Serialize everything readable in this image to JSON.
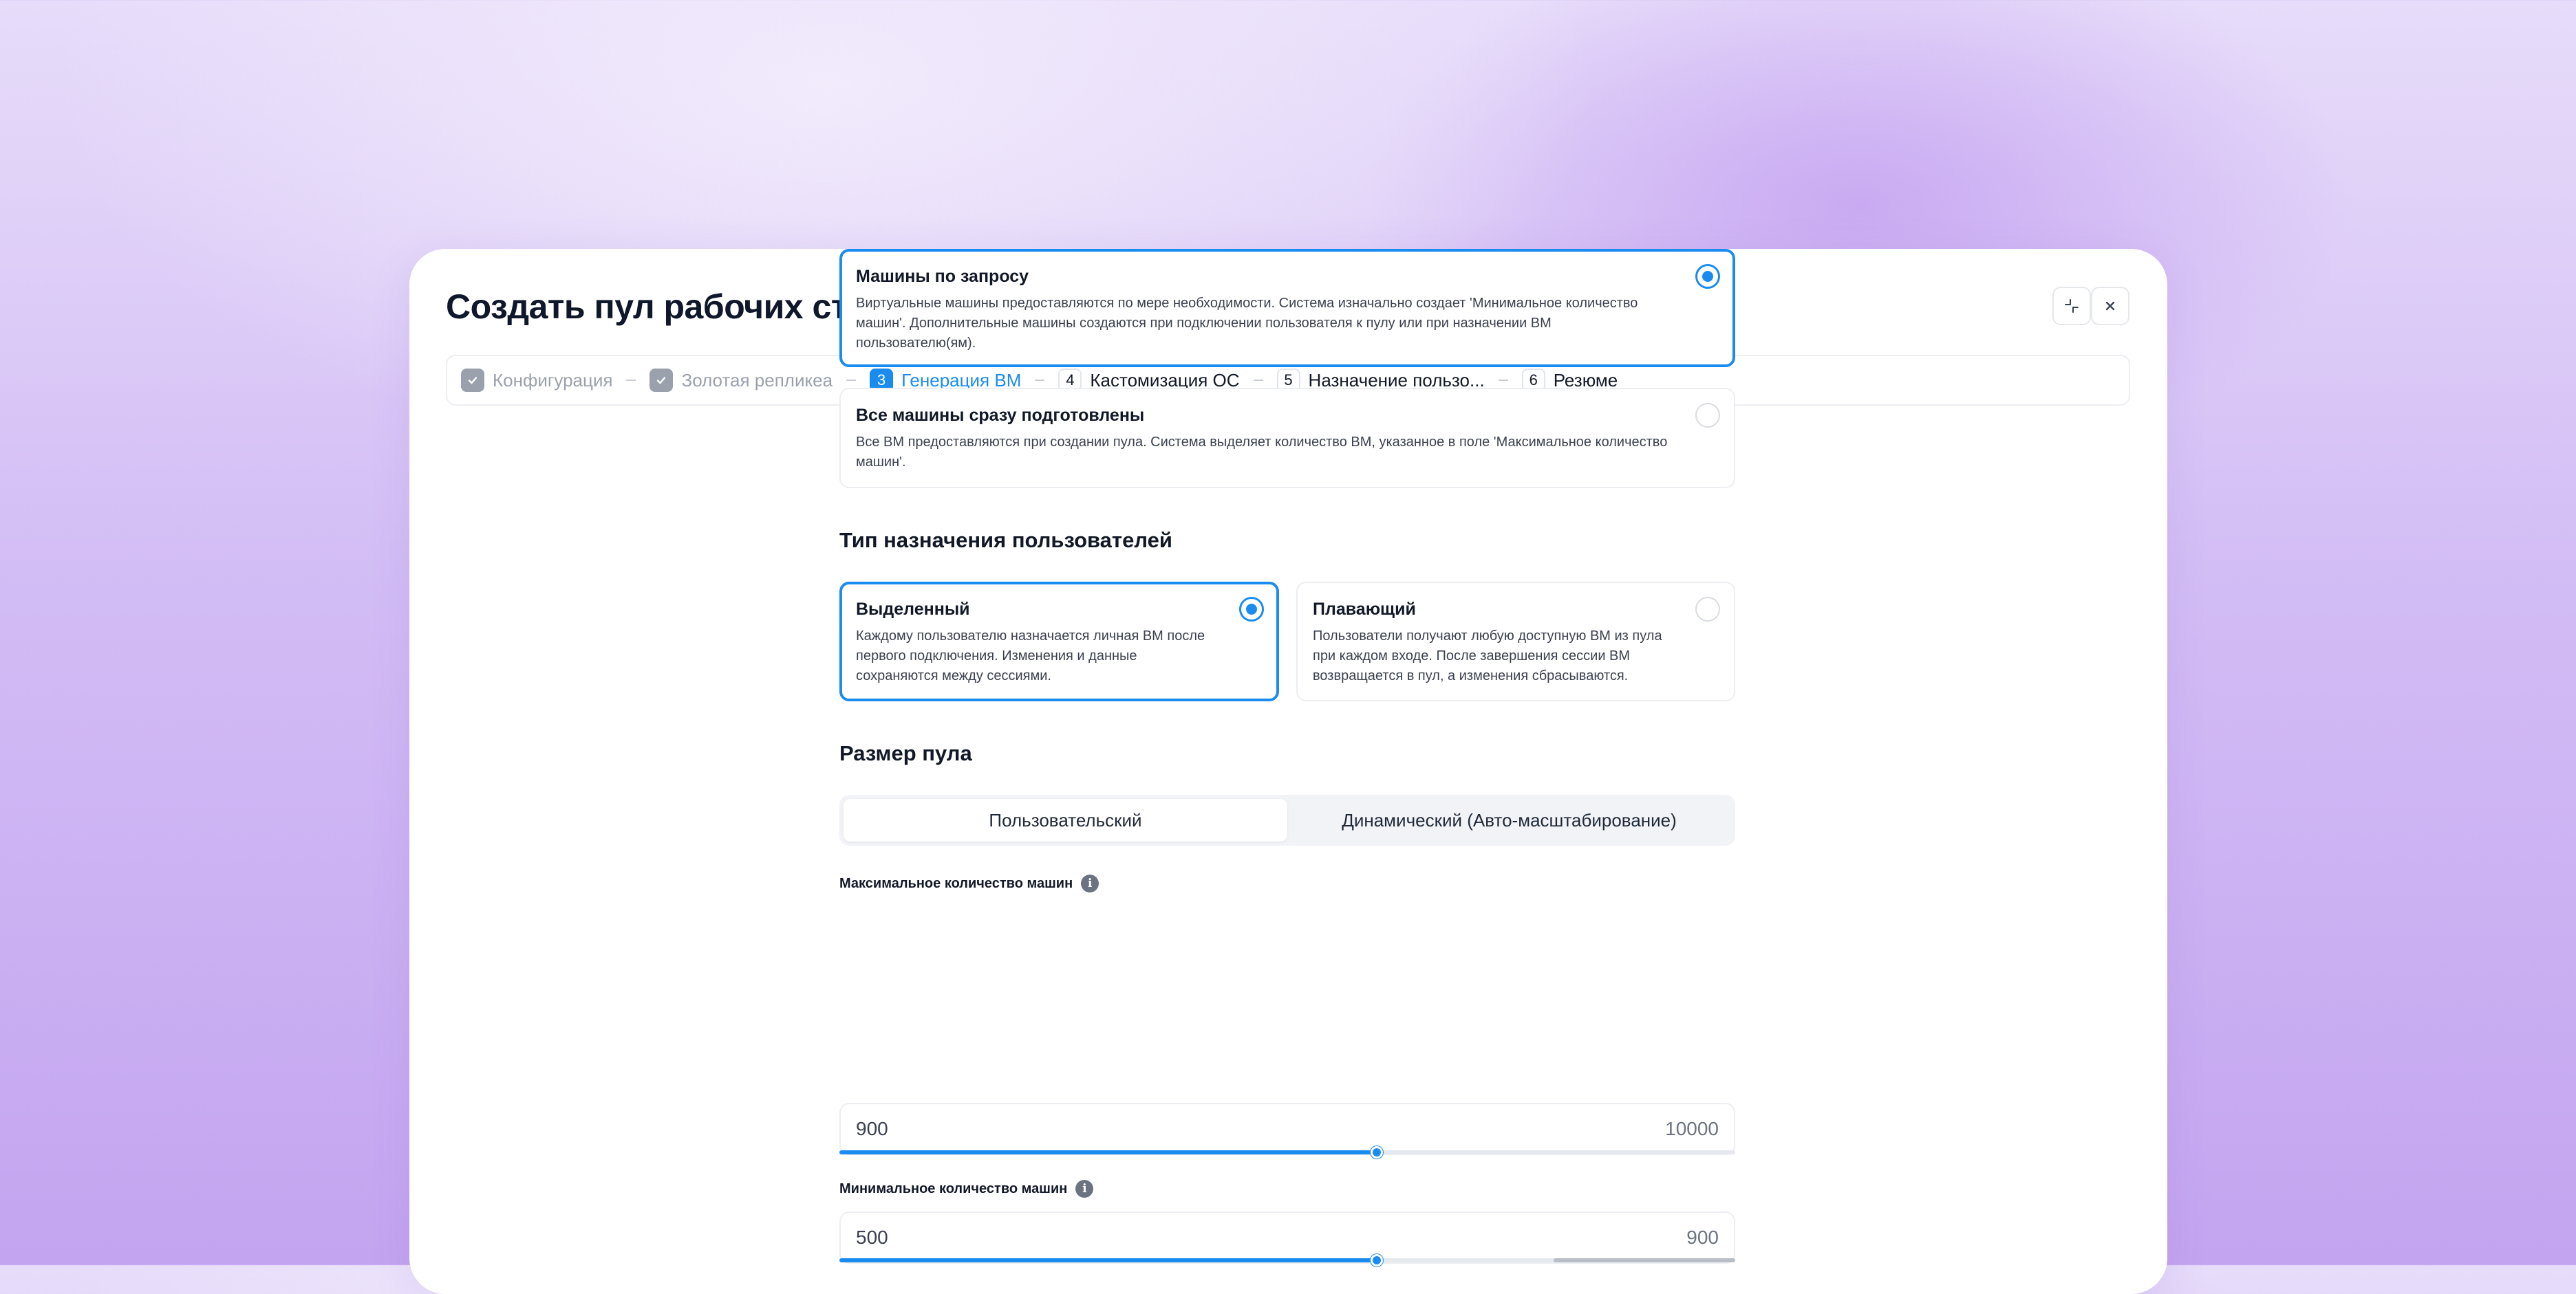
{
  "dialog": {
    "title": "Создать пул рабочих станций"
  },
  "stepper": {
    "steps": [
      {
        "label": "Конфигурация",
        "state": "done",
        "mark": "✓"
      },
      {
        "label": "Золотая репликеа",
        "state": "done",
        "mark": "✓"
      },
      {
        "label": "Генерация ВМ",
        "state": "active",
        "mark": "3"
      },
      {
        "label": "Кастомизация ОС",
        "state": "todo",
        "mark": "4"
      },
      {
        "label": "Назначение пользо...",
        "state": "todo",
        "mark": "5"
      },
      {
        "label": "Резюме",
        "state": "todo",
        "mark": "6"
      }
    ]
  },
  "provisioning": {
    "options": [
      {
        "title": "Машины по запросу",
        "description": "Виртуальные машины предоставляются по мере необходимости. Система изначально создает 'Минимальное количество машин'. Дополнительные машины создаются при подключении пользователя к пулу или при назначении ВМ пользователю(ям).",
        "selected": true
      },
      {
        "title": "Все машины сразу подготовлены",
        "description": "Все ВМ предоставляются при создании пула. Система выделяет количество ВМ, указанное в поле 'Максимальное количество машин'.",
        "selected": false
      }
    ]
  },
  "assignment": {
    "heading": "Тип назначения пользователей",
    "options": [
      {
        "title": "Выделенный",
        "description": "Каждому пользователю назначается личная ВМ после первого подключения. Изменения и данные сохраняются между сессиями.",
        "selected": true
      },
      {
        "title": "Плавающий",
        "description": "Пользователи получают любую доступную ВМ из пула при каждом входе. После завершения сессии ВМ возвращается в пул, а изменения сбрасываются.",
        "selected": false
      }
    ]
  },
  "pool_size": {
    "heading": "Размер пула",
    "tabs": [
      "Пользовательский",
      "Динамический (Авто-масштабирование)"
    ],
    "active_tab": 0,
    "max_machines": {
      "label": "Максимальное количество машин",
      "value": "900",
      "limit": "10000",
      "slider_fraction": 0.6
    },
    "min_machines": {
      "label": "Минимальное количество машин",
      "value": "500",
      "limit": "900",
      "slider_fraction": 0.6
    }
  },
  "colors": {
    "accent": "#1a8cf0",
    "muted": "#9aa1ad"
  }
}
